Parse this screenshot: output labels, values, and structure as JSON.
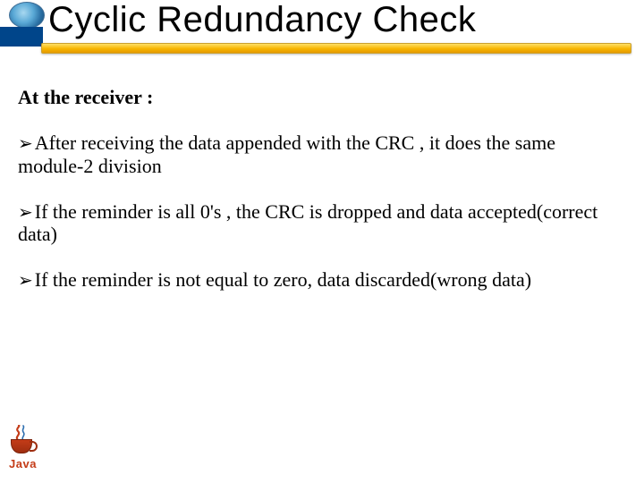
{
  "title": "Cyclic Redundancy Check",
  "heading": "At the receiver :",
  "bullets": [
    "After receiving the data appended with the CRC , it does the same module-2 division",
    "If the reminder is all 0's , the CRC is dropped and data accepted(correct data)",
    "If the reminder is not equal to zero, data discarded(wrong data)"
  ],
  "logo_text": "Java",
  "bullet_glyph": "➢"
}
